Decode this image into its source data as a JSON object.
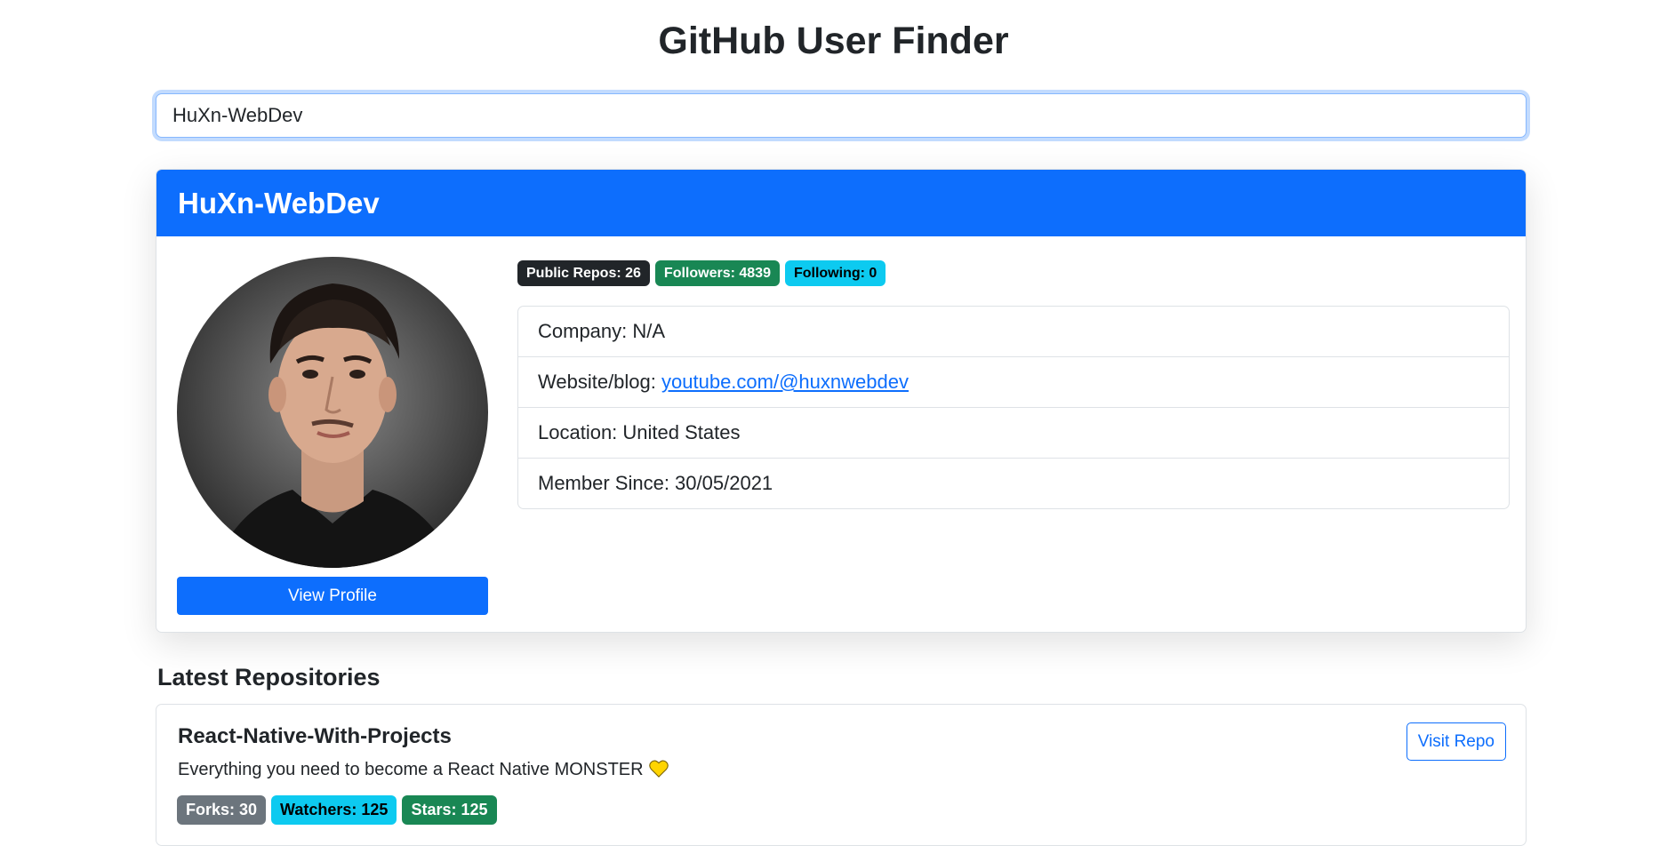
{
  "app": {
    "title": "GitHub User Finder"
  },
  "search": {
    "value": "HuXn-WebDev"
  },
  "profile": {
    "username": "HuXn-WebDev",
    "view_profile_label": "View Profile",
    "badges": {
      "public_repos": "Public Repos: 26",
      "followers": "Followers: 4839",
      "following": "Following: 0"
    },
    "info": {
      "company": "Company: N/A",
      "website_label": "Website/blog: ",
      "website_link": "youtube.com/@huxnwebdev",
      "location": "Location: United States",
      "member_since": "Member Since: 30/05/2021"
    }
  },
  "repos": {
    "section_title": "Latest Repositories",
    "items": [
      {
        "name": "React-Native-With-Projects",
        "description": "Everything you need to become a React Native MONSTER",
        "visit_label": "Visit Repo",
        "forks": "Forks: 30",
        "watchers": "Watchers: 125",
        "stars": "Stars: 125"
      }
    ]
  },
  "colors": {
    "primary": "#0d6efd",
    "dark": "#212529",
    "success": "#198754",
    "info": "#0dcaf0",
    "secondary": "#6c757d",
    "heart": "#ffd400"
  }
}
